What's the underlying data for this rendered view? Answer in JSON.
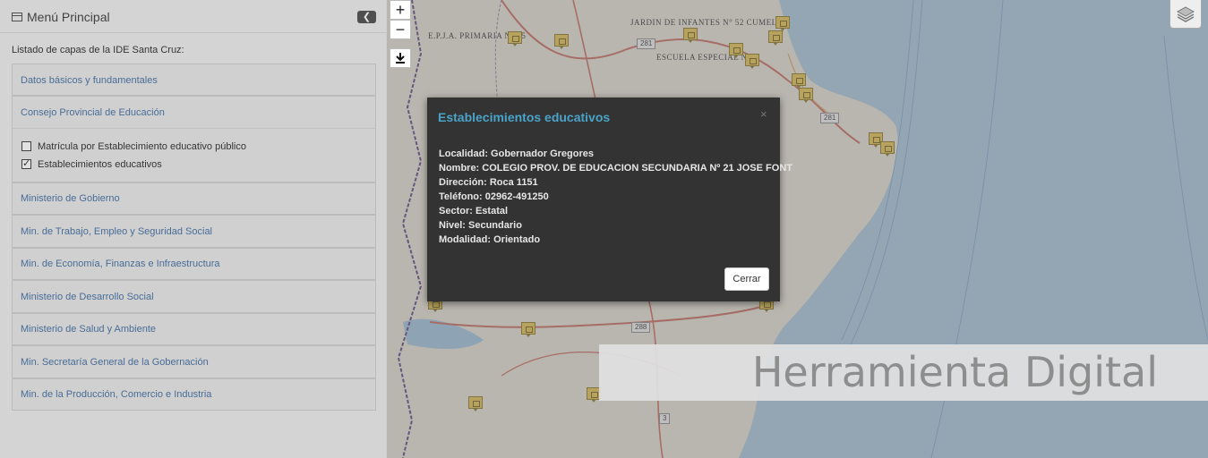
{
  "map": {
    "labels": [
      "E.P.J.A. PRIMARIA N° 15",
      "JARDIN DE INFANTES N° 52 CUMELEN",
      "ESCUELA ESPECIAL N° 3"
    ],
    "routes": [
      "281",
      "281",
      "288",
      "3"
    ],
    "zoom_in": "+",
    "zoom_out": "−",
    "download_icon": "download-icon",
    "layers_icon": "layers-icon"
  },
  "sidebar": {
    "title": "Menú Principal",
    "collapse_label": "❮",
    "caption": "Listado de capas de la IDE Santa Cruz:",
    "groups": [
      {
        "label": "Datos básicos y fundamentales"
      },
      {
        "label": "Consejo Provincial de Educación"
      },
      {
        "label": "Ministerio de Gobierno"
      },
      {
        "label": "Min. de Trabajo, Empleo y Seguridad Social"
      },
      {
        "label": "Min. de Economía, Finanzas e Infraestructura"
      },
      {
        "label": "Ministerio de Desarrollo Social"
      },
      {
        "label": "Ministerio de Salud y Ambiente"
      },
      {
        "label": "Min. Secretaría General de la Gobernación"
      },
      {
        "label": "Min. de la Producción, Comercio e Industria"
      }
    ],
    "education_layers": [
      {
        "label": "Matrícula por Establecimiento educativo público",
        "checked": false
      },
      {
        "label": "Establecimientos educativos",
        "checked": true
      }
    ]
  },
  "modal": {
    "title": "Establecimientos educativos",
    "close_x": "×",
    "lines": [
      "Localidad: Gobernador Gregores",
      "Nombre: COLEGIO PROV. DE EDUCACION SECUNDARIA Nº 21 JOSE FONT",
      "Dirección: Roca 1151",
      "Teléfono: 02962-491250",
      "Sector: Estatal",
      "Nivel: Secundario",
      "Modalidad: Orientado"
    ],
    "close_button": "Cerrar"
  },
  "banner": {
    "text": "Herramienta Digital"
  },
  "colors": {
    "land": "#e9e4d8",
    "sea": "#9fc3de",
    "modal_bg": "#333333",
    "modal_title": "#4aa3c8",
    "link": "#3b6aa0",
    "poi": "#e6c34a"
  }
}
